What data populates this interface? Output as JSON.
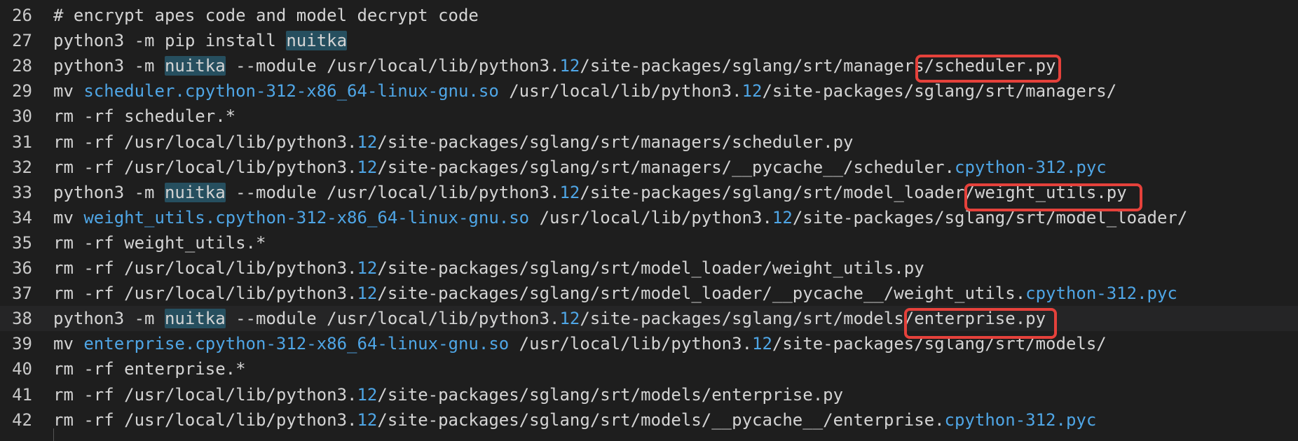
{
  "editor": {
    "lines": [
      {
        "num": "26",
        "segments": [
          {
            "t": "# encrypt apes code and model decrypt code",
            "k": "comment"
          }
        ]
      },
      {
        "num": "27",
        "segments": [
          {
            "t": "python3 -m pip install ",
            "k": "plain"
          },
          {
            "t": "nuitka",
            "k": "hl"
          }
        ]
      },
      {
        "num": "28",
        "segments": [
          {
            "t": "python3 -m ",
            "k": "plain"
          },
          {
            "t": "nuitka",
            "k": "hl"
          },
          {
            "t": " --module /usr/local/lib/python3.",
            "k": "plain"
          },
          {
            "t": "12",
            "k": "num"
          },
          {
            "t": "/site-packages/sglang/srt/managers/scheduler.py",
            "k": "plain"
          }
        ]
      },
      {
        "num": "29",
        "segments": [
          {
            "t": "mv ",
            "k": "plain"
          },
          {
            "t": "scheduler.cpython-312-x86_64-linux-gnu.so",
            "k": "fn"
          },
          {
            "t": " /usr/local/lib/python3.",
            "k": "plain"
          },
          {
            "t": "12",
            "k": "num"
          },
          {
            "t": "/site-packages/sglang/srt/managers/",
            "k": "plain"
          }
        ]
      },
      {
        "num": "30",
        "segments": [
          {
            "t": "rm -rf scheduler.*",
            "k": "plain"
          }
        ]
      },
      {
        "num": "31",
        "segments": [
          {
            "t": "rm -rf /usr/local/lib/python3.",
            "k": "plain"
          },
          {
            "t": "12",
            "k": "num"
          },
          {
            "t": "/site-packages/sglang/srt/managers/scheduler.py",
            "k": "plain"
          }
        ]
      },
      {
        "num": "32",
        "segments": [
          {
            "t": "rm -rf /usr/local/lib/python3.",
            "k": "plain"
          },
          {
            "t": "12",
            "k": "num"
          },
          {
            "t": "/site-packages/sglang/srt/managers/__pycache__/scheduler.",
            "k": "plain"
          },
          {
            "t": "cpython-312.pyc",
            "k": "fn"
          }
        ]
      },
      {
        "num": "33",
        "segments": [
          {
            "t": "python3 -m ",
            "k": "plain"
          },
          {
            "t": "nuitka",
            "k": "hl"
          },
          {
            "t": " --module /usr/local/lib/python3.",
            "k": "plain"
          },
          {
            "t": "12",
            "k": "num"
          },
          {
            "t": "/site-packages/sglang/srt/model_loader/weight_utils.py",
            "k": "plain"
          }
        ]
      },
      {
        "num": "34",
        "segments": [
          {
            "t": "mv ",
            "k": "plain"
          },
          {
            "t": "weight_utils.cpython-312-x86_64-linux-gnu.so",
            "k": "fn"
          },
          {
            "t": " /usr/local/lib/python3.",
            "k": "plain"
          },
          {
            "t": "12",
            "k": "num"
          },
          {
            "t": "/site-packages/sglang/srt/model_loader/",
            "k": "plain"
          }
        ]
      },
      {
        "num": "35",
        "segments": [
          {
            "t": "rm -rf weight_utils.*",
            "k": "plain"
          }
        ]
      },
      {
        "num": "36",
        "segments": [
          {
            "t": "rm -rf /usr/local/lib/python3.",
            "k": "plain"
          },
          {
            "t": "12",
            "k": "num"
          },
          {
            "t": "/site-packages/sglang/srt/model_loader/weight_utils.py",
            "k": "plain"
          }
        ]
      },
      {
        "num": "37",
        "segments": [
          {
            "t": "rm -rf /usr/local/lib/python3.",
            "k": "plain"
          },
          {
            "t": "12",
            "k": "num"
          },
          {
            "t": "/site-packages/sglang/srt/model_loader/__pycache__/weight_utils.",
            "k": "plain"
          },
          {
            "t": "cpython-312.pyc",
            "k": "fn"
          }
        ]
      },
      {
        "num": "38",
        "current": true,
        "segments": [
          {
            "t": "python3 -m ",
            "k": "plain"
          },
          {
            "t": "nuitka",
            "k": "hl"
          },
          {
            "t": " --module /usr/local/lib/python3.",
            "k": "plain"
          },
          {
            "t": "12",
            "k": "num"
          },
          {
            "t": "/site-packages/sglang/srt/models/enterprise.py",
            "k": "plain"
          }
        ]
      },
      {
        "num": "39",
        "segments": [
          {
            "t": "mv ",
            "k": "plain"
          },
          {
            "t": "enterprise.cpython-312-x86_64-linux-gnu.so",
            "k": "fn"
          },
          {
            "t": " /usr/local/lib/python3.",
            "k": "plain"
          },
          {
            "t": "12",
            "k": "num"
          },
          {
            "t": "/site-packages/sglang/srt/models/",
            "k": "plain"
          }
        ]
      },
      {
        "num": "40",
        "segments": [
          {
            "t": "rm -rf enterprise.*",
            "k": "plain"
          }
        ]
      },
      {
        "num": "41",
        "segments": [
          {
            "t": "rm -rf /usr/local/lib/python3.",
            "k": "plain"
          },
          {
            "t": "12",
            "k": "num"
          },
          {
            "t": "/site-packages/sglang/srt/models/enterprise.py",
            "k": "plain"
          }
        ]
      },
      {
        "num": "42",
        "segments": [
          {
            "t": "rm -rf /usr/local/lib/python3.",
            "k": "plain"
          },
          {
            "t": "12",
            "k": "num"
          },
          {
            "t": "/site-packages/sglang/srt/models/__pycache__/enterprise.",
            "k": "plain"
          },
          {
            "t": "cpython-312.pyc",
            "k": "fn"
          }
        ]
      }
    ]
  },
  "colors": {
    "background": "#1e1e1e",
    "text": "#d4d4d4",
    "path_blue": "#4fa6e6",
    "highlight": "#264f5f",
    "annotation_red": "#e5413b"
  }
}
